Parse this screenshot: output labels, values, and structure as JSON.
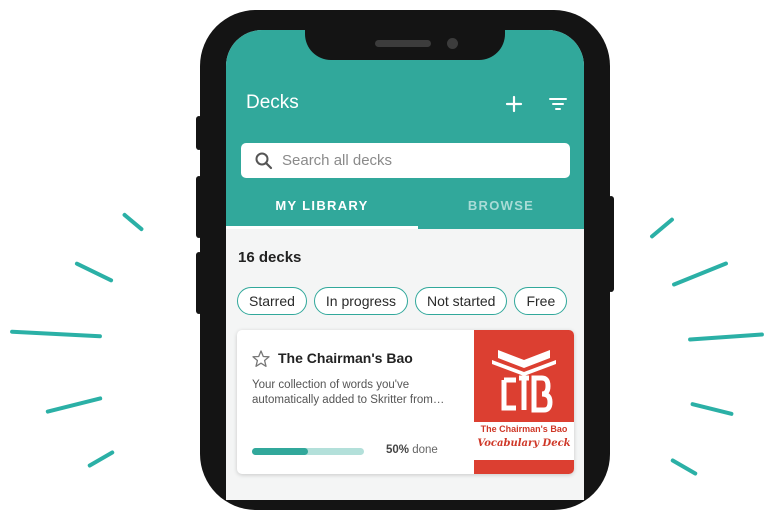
{
  "header": {
    "title": "Decks",
    "add_icon": "plus-icon",
    "filter_icon": "filter-icon"
  },
  "search": {
    "placeholder": "Search all decks",
    "icon": "search-icon"
  },
  "tabs": [
    {
      "label": "MY LIBRARY",
      "active": true
    },
    {
      "label": "BROWSE",
      "active": false
    }
  ],
  "deck_count": "16 decks",
  "filters": [
    "Starred",
    "In progress",
    "Not started",
    "Free"
  ],
  "deck": {
    "title": "The Chairman's Bao",
    "description": "Your collection of words you've automatically added to Skritter from…",
    "progress_value": "50%",
    "progress_suffix": "done",
    "progress_fraction": 0.5,
    "thumbnail": {
      "line1": "The Chairman's Bao",
      "line2": "Vocabulary Deck"
    }
  },
  "colors": {
    "accent": "#31a89b",
    "thumbnail_red": "#dc3f31"
  }
}
